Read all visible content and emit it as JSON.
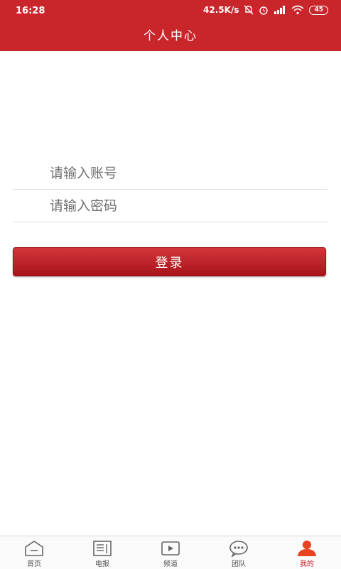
{
  "status_bar": {
    "time": "16:28",
    "network_speed": "42.5K/s",
    "battery": "45"
  },
  "header": {
    "title": "个人中心"
  },
  "login_form": {
    "account_placeholder": "请输入账号",
    "password_placeholder": "请输入密码",
    "login_label": "登录"
  },
  "tab_bar": {
    "items": [
      {
        "label": "首页",
        "icon": "home-icon",
        "active": false
      },
      {
        "label": "电报",
        "icon": "newspaper-icon",
        "active": false
      },
      {
        "label": "频道",
        "icon": "play-icon",
        "active": false
      },
      {
        "label": "团队",
        "icon": "chat-icon",
        "active": false
      },
      {
        "label": "我的",
        "icon": "user-icon",
        "active": true
      }
    ]
  },
  "colors": {
    "brand_red": "#c9262c",
    "tab_inactive": "#555555"
  }
}
